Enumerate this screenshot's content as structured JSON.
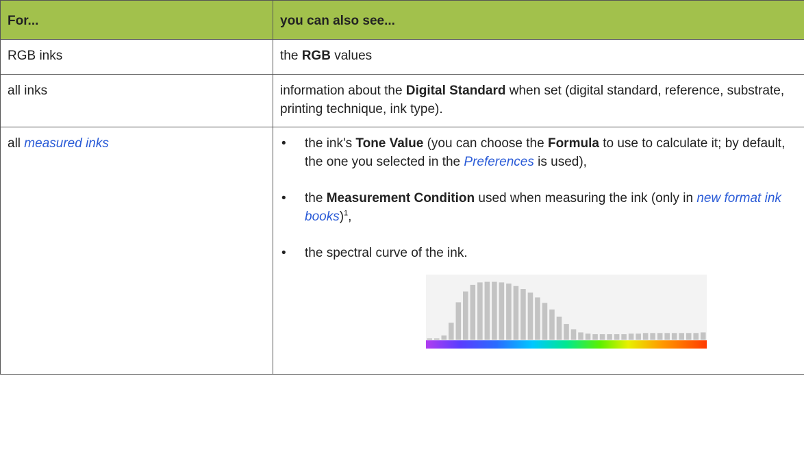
{
  "table": {
    "header": {
      "col1": "For...",
      "col2": "you can also see..."
    },
    "rows": [
      {
        "col1": "RGB inks",
        "col2": {
          "pre": "the ",
          "bold": "RGB",
          "post": " values"
        }
      },
      {
        "col1": "all inks",
        "col2": {
          "pre": "information about the ",
          "bold": "Digital Standard",
          "post": " when set (digital standard, reference, substrate, printing technique, ink type)."
        }
      },
      {
        "col1_pre": "all ",
        "col1_link": "measured inks",
        "bullets": [
          {
            "t1": "the ink's ",
            "b1": "Tone Value",
            "t2": " (you can choose the ",
            "b2": "Formula",
            "t3": " to use to calculate it; by default, the one you selected in the ",
            "link": "Preferences",
            "t4": " is used),"
          },
          {
            "t1": "the ",
            "b1": "Measurement Condition",
            "t2": " used when measuring the ink (only in ",
            "link": "new format ink books",
            "t3": ")",
            "footnote": "1",
            "t4": ","
          },
          {
            "t1": "the spectral curve of the ink."
          }
        ]
      }
    ]
  },
  "bullet_glyph": "•",
  "colors": {
    "header_bg": "#a2c14c",
    "link": "#2a5bd7",
    "border": "#555555"
  },
  "chart_data": {
    "type": "bar",
    "values": [
      2,
      2,
      7,
      28,
      62,
      80,
      91,
      95,
      96,
      96,
      95,
      93,
      89,
      84,
      78,
      70,
      61,
      50,
      38,
      26,
      17,
      12,
      10,
      9,
      9,
      9,
      9,
      9,
      10,
      10,
      11,
      11,
      11,
      11,
      11,
      11,
      11,
      11,
      12
    ],
    "ylim": [
      0,
      100
    ],
    "bar_color": "#c3c3c3",
    "gradient_strip": true
  }
}
